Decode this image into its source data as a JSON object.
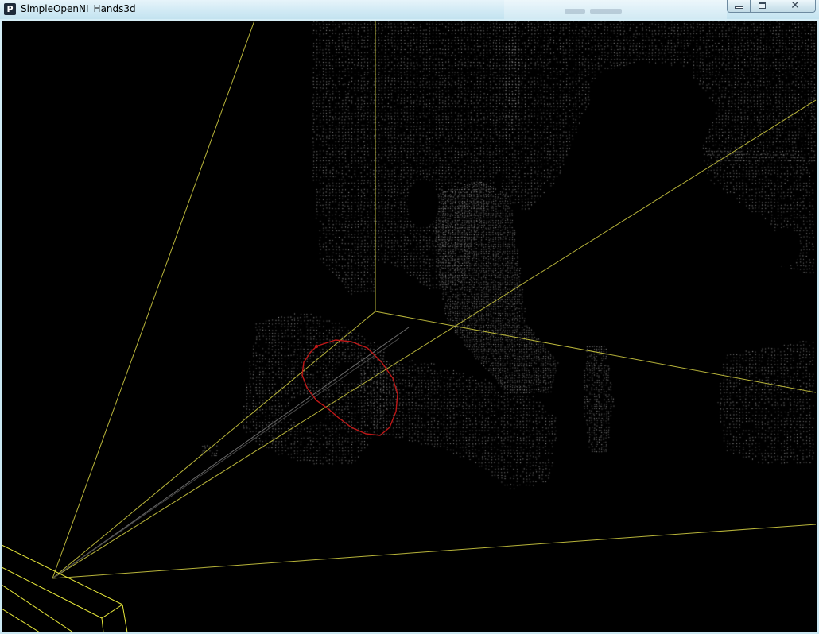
{
  "window": {
    "title": "SimpleOpenNI_Hands3d",
    "app_icon_letter": "P",
    "controls": {
      "minimize_icon": "minimize-icon",
      "maximize_icon": "maximize-icon",
      "close_icon": "close-icon",
      "close_glyph": "✕"
    }
  },
  "scene": {
    "background_color": "#000000",
    "point_cloud_color": "#bdbdbd",
    "frustum_color": "#b8b43a",
    "hand_trail_color": "#c01818",
    "kinect_box_color": "#e8e83a"
  }
}
